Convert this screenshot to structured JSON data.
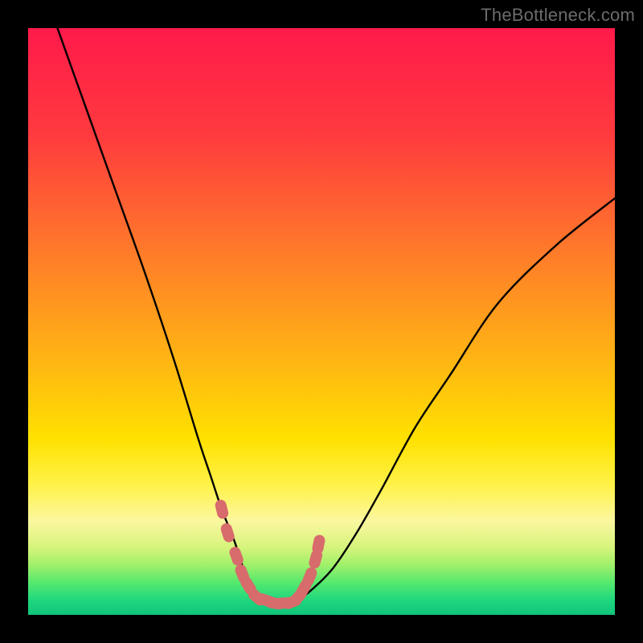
{
  "watermark": "TheBottleneck.com",
  "colors": {
    "frame_background": "#000000",
    "watermark_text": "#6b6b6b",
    "curve_stroke": "#000000",
    "marker_fill": "#d86b6b",
    "gradient_stops": [
      {
        "offset": 0.0,
        "color": "#ff1a4b"
      },
      {
        "offset": 0.18,
        "color": "#ff3a3e"
      },
      {
        "offset": 0.38,
        "color": "#ff7a2a"
      },
      {
        "offset": 0.55,
        "color": "#ffb015"
      },
      {
        "offset": 0.7,
        "color": "#ffe100"
      },
      {
        "offset": 0.78,
        "color": "#fff24a"
      },
      {
        "offset": 0.84,
        "color": "#fbf7a0"
      },
      {
        "offset": 0.885,
        "color": "#d6f47b"
      },
      {
        "offset": 0.915,
        "color": "#9ff06a"
      },
      {
        "offset": 0.945,
        "color": "#55e96e"
      },
      {
        "offset": 0.975,
        "color": "#1fd77e"
      },
      {
        "offset": 1.0,
        "color": "#11c47a"
      }
    ]
  },
  "chart_data": {
    "type": "line",
    "title": "",
    "xlabel": "",
    "ylabel": "",
    "xlim": [
      0,
      100
    ],
    "ylim": [
      0,
      100
    ],
    "grid": false,
    "legend": false,
    "note": "Values estimated visually from the rendered curve; y = 0 at bottom (green) and y = 100 at top (red). x is a normalized horizontal position.",
    "series": [
      {
        "name": "curve",
        "x": [
          5,
          10,
          15,
          20,
          25,
          29,
          31,
          33,
          35,
          36,
          37,
          38,
          40,
          42,
          43,
          45,
          48,
          52,
          56,
          60,
          66,
          72,
          80,
          90,
          100
        ],
        "y": [
          100,
          86,
          72,
          58,
          43,
          30,
          24,
          18,
          13,
          10,
          7,
          5,
          3,
          2,
          2,
          2,
          4,
          8,
          14,
          21,
          32,
          41,
          53,
          63,
          71
        ]
      }
    ],
    "markers": {
      "note": "Salmon-colored rounded markers near the valley of the curve",
      "points_xy": [
        [
          33,
          18
        ],
        [
          34,
          14
        ],
        [
          35.5,
          10
        ],
        [
          36.5,
          7
        ],
        [
          37.5,
          5
        ],
        [
          39,
          3
        ],
        [
          40.5,
          2.5
        ],
        [
          42,
          2
        ],
        [
          43.5,
          2
        ],
        [
          45,
          2.2
        ],
        [
          46,
          3
        ],
        [
          47,
          4.5
        ],
        [
          48,
          6.5
        ],
        [
          49,
          9.5
        ],
        [
          49.5,
          12
        ]
      ]
    }
  }
}
